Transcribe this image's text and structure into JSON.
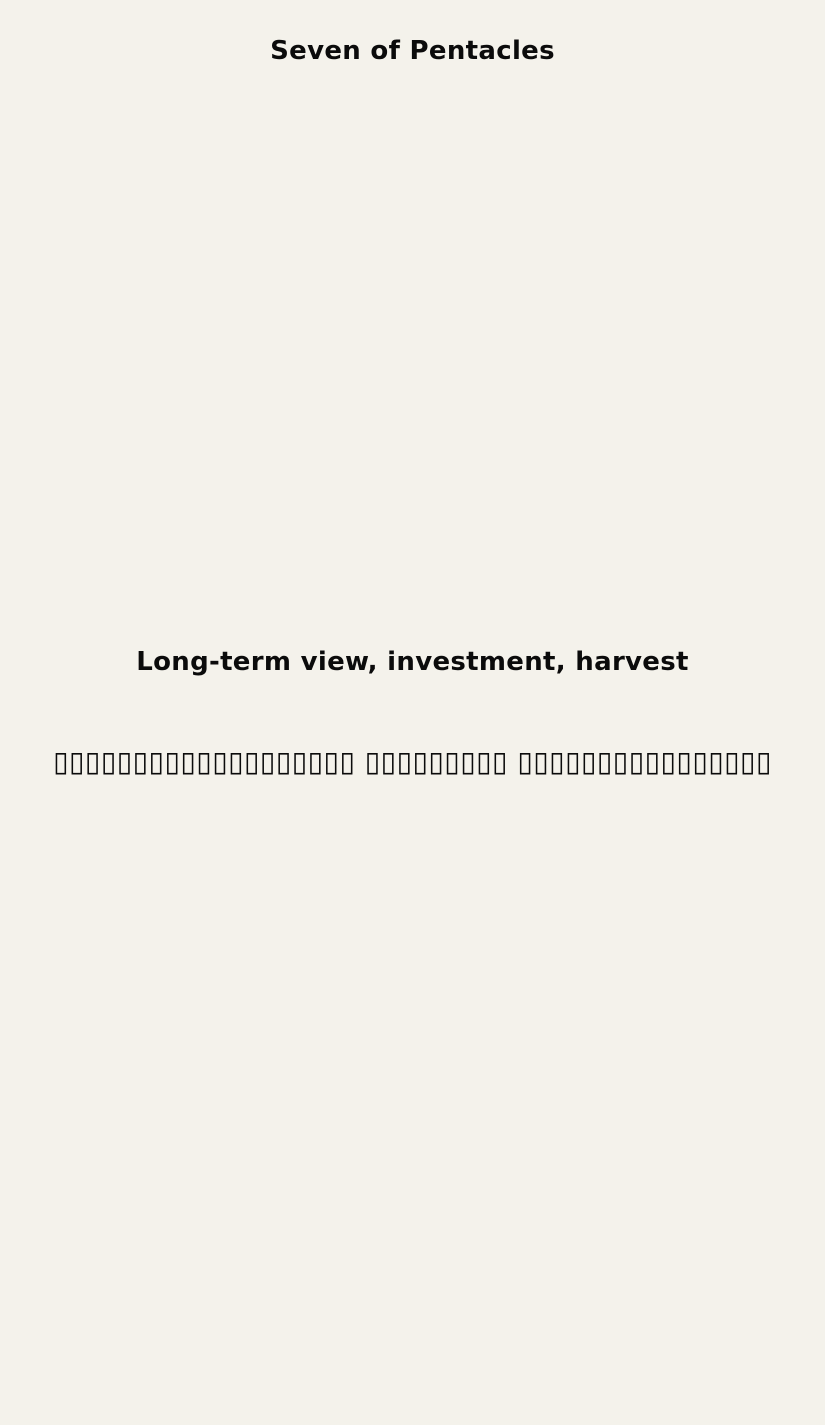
{
  "card": {
    "title": "Seven of Pentacles",
    "meaning": "Long-term view, investment, harvest",
    "translation": "▯▯▯▯▯▯▯▯▯▯▯▯▯▯▯▯▯▯▯ ▯▯▯▯▯▯▯▯▯ ▯▯▯▯▯▯▯▯▯▯▯▯▯▯▯▯"
  },
  "colors": {
    "background": "#f4f2eb",
    "text": "#0b0b0b"
  }
}
